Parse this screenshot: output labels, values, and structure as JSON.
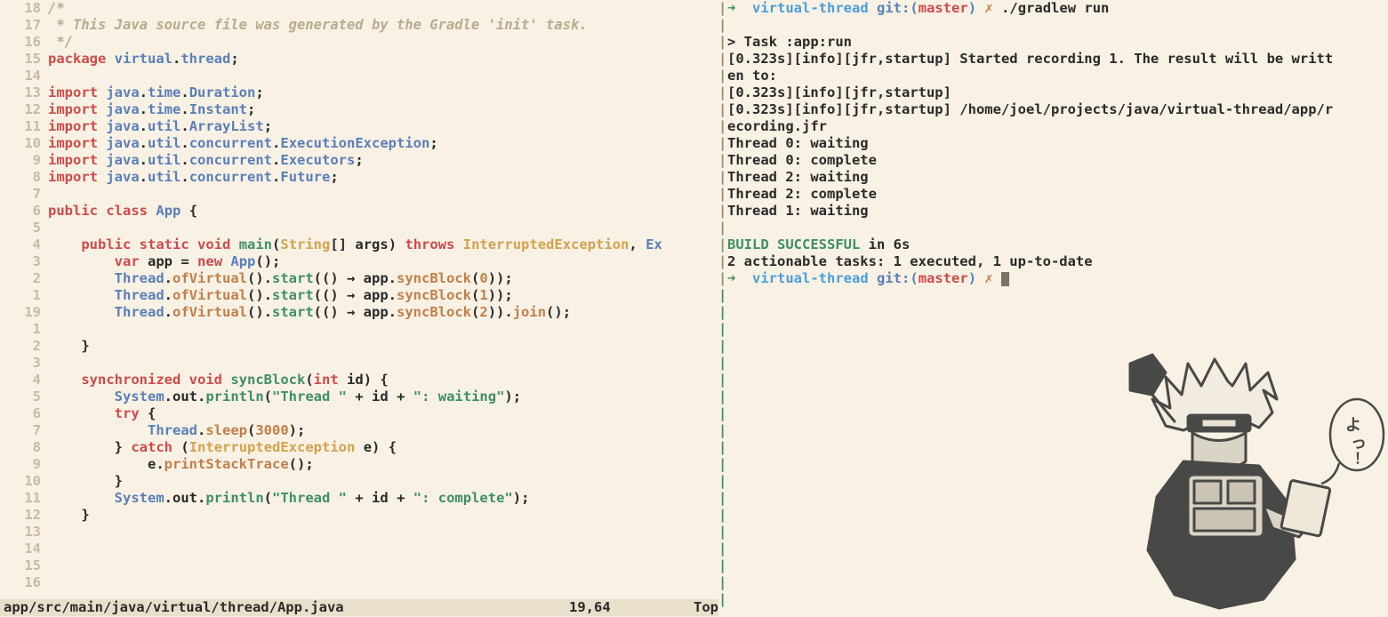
{
  "editor": {
    "lines": [
      {
        "n": "18",
        "t": "comment",
        "text": "/*"
      },
      {
        "n": "17",
        "t": "comment",
        "text": " * This Java source file was generated by the Gradle 'init' task."
      },
      {
        "n": "16",
        "t": "comment",
        "text": " */"
      },
      {
        "n": "15",
        "t": "pkg",
        "tokens": [
          [
            "kw",
            "package"
          ],
          [
            "sp",
            " "
          ],
          [
            "pkgb",
            "virtual"
          ],
          [
            "op",
            "."
          ],
          [
            "pkgb",
            "thread"
          ],
          [
            "op",
            ";"
          ]
        ]
      },
      {
        "n": "14",
        "t": "blank",
        "text": ""
      },
      {
        "n": "13",
        "t": "imp",
        "tokens": [
          [
            "kw",
            "import"
          ],
          [
            "sp",
            " "
          ],
          [
            "pkgb",
            "java"
          ],
          [
            "op",
            "."
          ],
          [
            "pkgb",
            "time"
          ],
          [
            "op",
            "."
          ],
          [
            "class",
            "Duration"
          ],
          [
            "op",
            ";"
          ]
        ]
      },
      {
        "n": "12",
        "t": "imp",
        "tokens": [
          [
            "kw",
            "import"
          ],
          [
            "sp",
            " "
          ],
          [
            "pkgb",
            "java"
          ],
          [
            "op",
            "."
          ],
          [
            "pkgb",
            "time"
          ],
          [
            "op",
            "."
          ],
          [
            "class",
            "Instant"
          ],
          [
            "op",
            ";"
          ]
        ]
      },
      {
        "n": "11",
        "t": "imp",
        "tokens": [
          [
            "kw",
            "import"
          ],
          [
            "sp",
            " "
          ],
          [
            "pkgb",
            "java"
          ],
          [
            "op",
            "."
          ],
          [
            "pkgb",
            "util"
          ],
          [
            "op",
            "."
          ],
          [
            "class",
            "ArrayList"
          ],
          [
            "op",
            ";"
          ]
        ]
      },
      {
        "n": "10",
        "t": "imp",
        "tokens": [
          [
            "kw",
            "import"
          ],
          [
            "sp",
            " "
          ],
          [
            "pkgb",
            "java"
          ],
          [
            "op",
            "."
          ],
          [
            "pkgb",
            "util"
          ],
          [
            "op",
            "."
          ],
          [
            "pkgb",
            "concurrent"
          ],
          [
            "op",
            "."
          ],
          [
            "class",
            "ExecutionException"
          ],
          [
            "op",
            ";"
          ]
        ]
      },
      {
        "n": "9",
        "t": "imp",
        "tokens": [
          [
            "kw",
            "import"
          ],
          [
            "sp",
            " "
          ],
          [
            "pkgb",
            "java"
          ],
          [
            "op",
            "."
          ],
          [
            "pkgb",
            "util"
          ],
          [
            "op",
            "."
          ],
          [
            "pkgb",
            "concurrent"
          ],
          [
            "op",
            "."
          ],
          [
            "class",
            "Executors"
          ],
          [
            "op",
            ";"
          ]
        ]
      },
      {
        "n": "8",
        "t": "imp",
        "tokens": [
          [
            "kw",
            "import"
          ],
          [
            "sp",
            " "
          ],
          [
            "pkgb",
            "java"
          ],
          [
            "op",
            "."
          ],
          [
            "pkgb",
            "util"
          ],
          [
            "op",
            "."
          ],
          [
            "pkgb",
            "concurrent"
          ],
          [
            "op",
            "."
          ],
          [
            "class",
            "Future"
          ],
          [
            "op",
            ";"
          ]
        ]
      },
      {
        "n": "7",
        "t": "blank",
        "text": ""
      },
      {
        "n": "6",
        "t": "code",
        "tokens": [
          [
            "kw",
            "public"
          ],
          [
            "sp",
            " "
          ],
          [
            "kw",
            "class"
          ],
          [
            "sp",
            " "
          ],
          [
            "class",
            "App"
          ],
          [
            "sp",
            " "
          ],
          [
            "op",
            "{"
          ]
        ]
      },
      {
        "n": "5",
        "t": "blank",
        "text": ""
      },
      {
        "n": "4",
        "t": "code",
        "tokens": [
          [
            "sp",
            "    "
          ],
          [
            "kw",
            "public"
          ],
          [
            "sp",
            " "
          ],
          [
            "kw",
            "static"
          ],
          [
            "sp",
            " "
          ],
          [
            "kw",
            "void"
          ],
          [
            "sp",
            " "
          ],
          [
            "func",
            "main"
          ],
          [
            "op",
            "("
          ],
          [
            "type",
            "String"
          ],
          [
            "op",
            "[]"
          ],
          [
            "sp",
            " "
          ],
          [
            "var",
            "args"
          ],
          [
            "op",
            ")"
          ],
          [
            "sp",
            " "
          ],
          [
            "kw",
            "throws"
          ],
          [
            "sp",
            " "
          ],
          [
            "type",
            "InterruptedException"
          ],
          [
            "op",
            ","
          ],
          [
            "sp",
            " "
          ],
          [
            "trunc",
            "Ex"
          ]
        ]
      },
      {
        "n": "3",
        "t": "code",
        "tokens": [
          [
            "sp",
            "        "
          ],
          [
            "kw",
            "var"
          ],
          [
            "sp",
            " "
          ],
          [
            "var",
            "app"
          ],
          [
            "sp",
            " "
          ],
          [
            "op",
            "="
          ],
          [
            "sp",
            " "
          ],
          [
            "kw",
            "new"
          ],
          [
            "sp",
            " "
          ],
          [
            "class",
            "App"
          ],
          [
            "op",
            "();"
          ]
        ]
      },
      {
        "n": "2",
        "t": "code",
        "tokens": [
          [
            "sp",
            "        "
          ],
          [
            "class",
            "Thread"
          ],
          [
            "op",
            "."
          ],
          [
            "mbrown",
            "ofVirtual"
          ],
          [
            "op",
            "()."
          ],
          [
            "func",
            "start"
          ],
          [
            "op",
            "(() "
          ],
          [
            "op",
            "→"
          ],
          [
            "op",
            " app."
          ],
          [
            "mbrown",
            "syncBlock"
          ],
          [
            "op",
            "("
          ],
          [
            "num",
            "0"
          ],
          [
            "op",
            "));"
          ]
        ]
      },
      {
        "n": "1",
        "t": "code",
        "tokens": [
          [
            "sp",
            "        "
          ],
          [
            "class",
            "Thread"
          ],
          [
            "op",
            "."
          ],
          [
            "mbrown",
            "ofVirtual"
          ],
          [
            "op",
            "()."
          ],
          [
            "func",
            "start"
          ],
          [
            "op",
            "(() "
          ],
          [
            "op",
            "→"
          ],
          [
            "op",
            " app."
          ],
          [
            "mbrown",
            "syncBlock"
          ],
          [
            "op",
            "("
          ],
          [
            "num",
            "1"
          ],
          [
            "op",
            "));"
          ]
        ]
      },
      {
        "n": "19",
        "t": "code",
        "tokens": [
          [
            "sp",
            "        "
          ],
          [
            "class",
            "Thread"
          ],
          [
            "op",
            "."
          ],
          [
            "mbrown",
            "ofVirtual"
          ],
          [
            "op",
            "()."
          ],
          [
            "func",
            "start"
          ],
          [
            "op",
            "(() "
          ],
          [
            "op",
            "→"
          ],
          [
            "op",
            " app."
          ],
          [
            "mbrown",
            "syncBlock"
          ],
          [
            "op",
            "("
          ],
          [
            "num",
            "2"
          ],
          [
            "op",
            "))."
          ],
          [
            "mbrown",
            "join"
          ],
          [
            "op",
            "();"
          ]
        ]
      },
      {
        "n": "1",
        "t": "blank",
        "text": ""
      },
      {
        "n": "2",
        "t": "code",
        "tokens": [
          [
            "sp",
            "    "
          ],
          [
            "op",
            "}"
          ]
        ]
      },
      {
        "n": "3",
        "t": "blank",
        "text": ""
      },
      {
        "n": "4",
        "t": "code",
        "tokens": [
          [
            "sp",
            "    "
          ],
          [
            "kw",
            "synchronized"
          ],
          [
            "sp",
            " "
          ],
          [
            "kw",
            "void"
          ],
          [
            "sp",
            " "
          ],
          [
            "func",
            "syncBlock"
          ],
          [
            "op",
            "("
          ],
          [
            "kw",
            "int"
          ],
          [
            "sp",
            " "
          ],
          [
            "var",
            "id"
          ],
          [
            "op",
            ") {"
          ]
        ]
      },
      {
        "n": "5",
        "t": "code",
        "tokens": [
          [
            "sp",
            "        "
          ],
          [
            "class",
            "System"
          ],
          [
            "op",
            "."
          ],
          [
            "var",
            "out"
          ],
          [
            "op",
            "."
          ],
          [
            "func",
            "println"
          ],
          [
            "op",
            "("
          ],
          [
            "str",
            "\"Thread \""
          ],
          [
            "sp",
            " "
          ],
          [
            "op",
            "+"
          ],
          [
            "sp",
            " "
          ],
          [
            "var",
            "id"
          ],
          [
            "sp",
            " "
          ],
          [
            "op",
            "+"
          ],
          [
            "sp",
            " "
          ],
          [
            "str",
            "\": waiting\""
          ],
          [
            "op",
            ");"
          ]
        ]
      },
      {
        "n": "6",
        "t": "code",
        "tokens": [
          [
            "sp",
            "        "
          ],
          [
            "kw",
            "try"
          ],
          [
            "sp",
            " "
          ],
          [
            "op",
            "{"
          ]
        ]
      },
      {
        "n": "7",
        "t": "code",
        "tokens": [
          [
            "sp",
            "            "
          ],
          [
            "class",
            "Thread"
          ],
          [
            "op",
            "."
          ],
          [
            "mbrown",
            "sleep"
          ],
          [
            "op",
            "("
          ],
          [
            "num",
            "3000"
          ],
          [
            "op",
            ");"
          ]
        ]
      },
      {
        "n": "8",
        "t": "code",
        "tokens": [
          [
            "sp",
            "        "
          ],
          [
            "op",
            "}"
          ],
          [
            "sp",
            " "
          ],
          [
            "kw",
            "catch"
          ],
          [
            "sp",
            " "
          ],
          [
            "op",
            "("
          ],
          [
            "type",
            "InterruptedException"
          ],
          [
            "sp",
            " "
          ],
          [
            "var",
            "e"
          ],
          [
            "op",
            ") {"
          ]
        ]
      },
      {
        "n": "9",
        "t": "code",
        "tokens": [
          [
            "sp",
            "            "
          ],
          [
            "var",
            "e"
          ],
          [
            "op",
            "."
          ],
          [
            "mbrown",
            "printStackTrace"
          ],
          [
            "op",
            "();"
          ]
        ]
      },
      {
        "n": "10",
        "t": "code",
        "tokens": [
          [
            "sp",
            "        "
          ],
          [
            "op",
            "}"
          ]
        ]
      },
      {
        "n": "11",
        "t": "code",
        "tokens": [
          [
            "sp",
            "        "
          ],
          [
            "class",
            "System"
          ],
          [
            "op",
            "."
          ],
          [
            "var",
            "out"
          ],
          [
            "op",
            "."
          ],
          [
            "func",
            "println"
          ],
          [
            "op",
            "("
          ],
          [
            "str",
            "\"Thread \""
          ],
          [
            "sp",
            " "
          ],
          [
            "op",
            "+"
          ],
          [
            "sp",
            " "
          ],
          [
            "var",
            "id"
          ],
          [
            "sp",
            " "
          ],
          [
            "op",
            "+"
          ],
          [
            "sp",
            " "
          ],
          [
            "str",
            "\": complete\""
          ],
          [
            "op",
            ");"
          ]
        ]
      },
      {
        "n": "12",
        "t": "code",
        "tokens": [
          [
            "sp",
            "    "
          ],
          [
            "op",
            "}"
          ]
        ]
      },
      {
        "n": "13",
        "t": "blank",
        "text": ""
      },
      {
        "n": "14",
        "t": "blank",
        "text": ""
      },
      {
        "n": "15",
        "t": "blank",
        "text": ""
      },
      {
        "n": "16",
        "t": "blank",
        "text": ""
      }
    ],
    "status": {
      "file": "app/src/main/java/virtual/thread/App.java",
      "pos": "19,64",
      "scroll": "Top"
    }
  },
  "terminal": {
    "prompt": {
      "arrow": "➜",
      "dir": "virtual-thread",
      "git": "git:",
      "branch": "master",
      "x": "✗"
    },
    "cmd": "./gradlew run",
    "lines": [
      "",
      "> Task :app:run",
      "[0.323s][info][jfr,startup] Started recording 1. The result will be writt",
      "en to:",
      "[0.323s][info][jfr,startup]",
      "[0.323s][info][jfr,startup] /home/joel/projects/java/virtual-thread/app/r",
      "ecording.jfr",
      "Thread 0: waiting",
      "Thread 0: complete",
      "Thread 2: waiting",
      "Thread 2: complete",
      "Thread 1: waiting",
      ""
    ],
    "build_ok": "BUILD SUCCESSFUL",
    "build_time": " in 6s",
    "summary": "2 actionable tasks: 1 executed, 1 up-to-date"
  }
}
